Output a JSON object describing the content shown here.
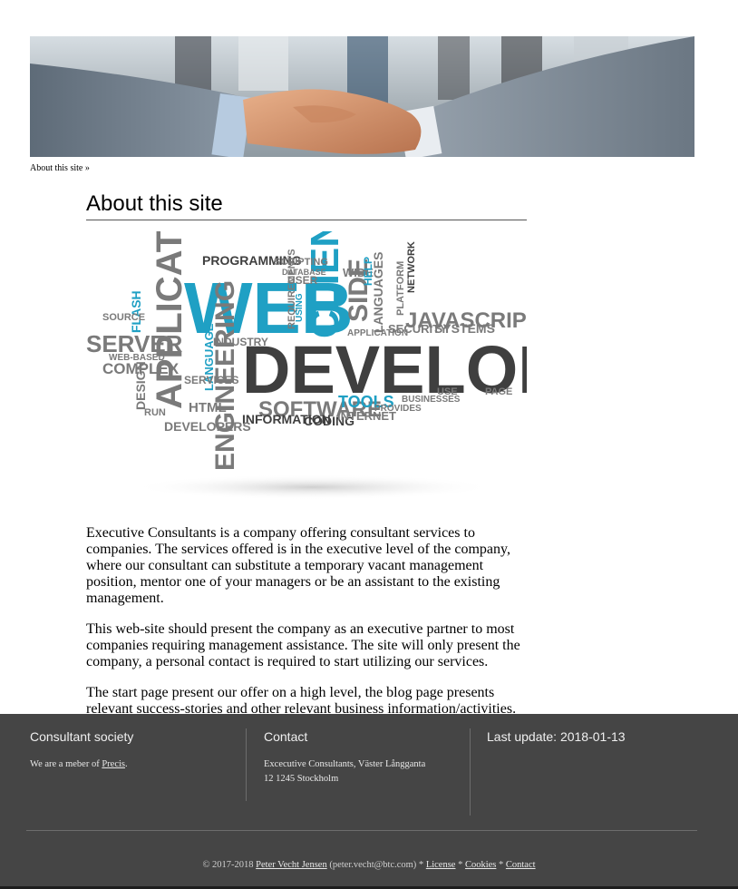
{
  "breadcrumb": {
    "label": "About this site »"
  },
  "page": {
    "title": "About this site"
  },
  "cloud_words": [
    "APPLICATIONS",
    "WEB",
    "CLIENT",
    "SIDE",
    "DEVELOPMENT",
    "JAVASCRIPT",
    "SERVER",
    "COMPLEX",
    "ENGINEERING",
    "SOFTWARE",
    "TOOLS",
    "INFORMATION",
    "CODING",
    "HTML",
    "DEVELOPERS",
    "PROGRAMMING",
    "SCRIPTING",
    "LANGUAGES",
    "SYSTEMS",
    "SECURITY",
    "INTERNET",
    "BUSINESSES",
    "PROVIDES",
    "DESIGN",
    "FLASH",
    "SOURCE",
    "WIDE",
    "PLATFORM",
    "NETWORK",
    "HELP",
    "APPLICATION",
    "INDUSTRY",
    "LANGUAGE",
    "SERVICES",
    "PAGE",
    "USE",
    "REQUIREMENTS",
    "USING",
    "USER",
    "DATABASE",
    "WEB-BASED",
    "RUN"
  ],
  "paragraphs": [
    "Executive Consultants is a company offering consultant services to companies. The services offered is in the executive level of the company, where our consultant can substitute a temporary vacant management position, mentor one of your managers or be an assistant to the existing management.",
    "This web-site should present the company as an executive partner to most companies requiring management assistance. The site will only present the company, a personal contact is required to start utilizing our services.",
    "The start page present our offer on a high level, the blog page presents relevant success-stories and other relevant business information/activities."
  ],
  "footer": {
    "col1": {
      "title": "Consultant society",
      "text": "We are a meber of ",
      "link": "Precis",
      "after": "."
    },
    "col2": {
      "title": "Contact",
      "line1": "Excecutive Consultants, Väster Långganta",
      "line2": "12 1245 Stockholm"
    },
    "col3": {
      "title": "Last update: 2018-01-13"
    },
    "bottom": {
      "prefix": "© 2017-2018 ",
      "author": "Peter Vecht Jensen",
      "email": " (peter.vecht@btc.com) * ",
      "license": "License",
      "sep1": " * ",
      "cookies": "Cookies",
      "sep2": " * ",
      "contact": "Contact"
    }
  },
  "colors": {
    "footer_bg": "#454545",
    "cloud_blue": "#1fa0c4",
    "cloud_dark": "#3f3f3f",
    "cloud_gray": "#7a7a7a"
  }
}
